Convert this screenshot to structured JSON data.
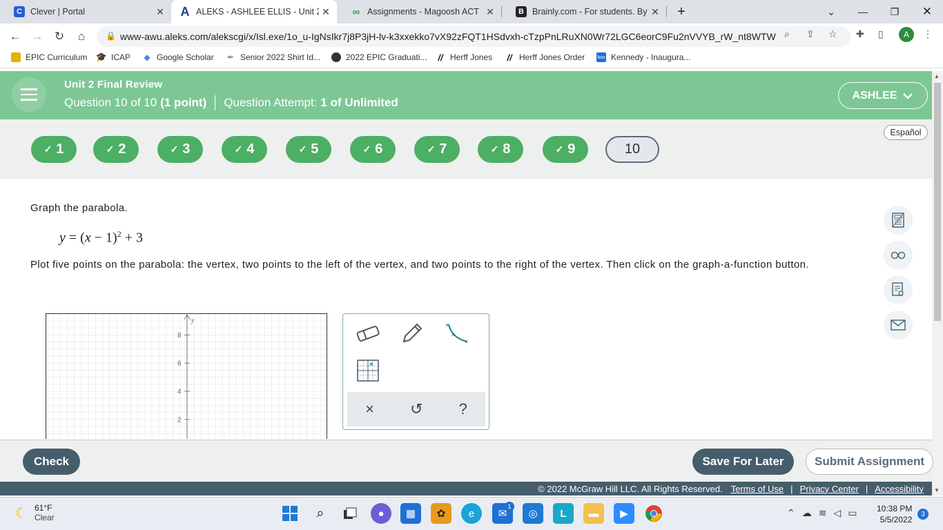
{
  "browser": {
    "tabs": [
      {
        "title": "Clever | Portal",
        "icon": "clever-icon",
        "color": "#2a5bd7",
        "glyph": "C"
      },
      {
        "title": "ALEKS - ASHLEE ELLIS - Unit 2 Fir",
        "icon": "aleks-icon",
        "color": "#ffffff",
        "glyph": "A"
      },
      {
        "title": "Assignments - Magoosh ACT",
        "icon": "magoosh-icon",
        "color": "#ffffff",
        "glyph": "∞"
      },
      {
        "title": "Brainly.com - For students. By stu",
        "icon": "brainly-icon",
        "color": "#222222",
        "glyph": "B"
      }
    ],
    "new_tab_label": "+",
    "url": "www-awu.aleks.com/alekscgi/x/Isl.exe/1o_u-IgNsIkr7j8P3jH-lv-k3xxekko7vX92zFQT1HSdvxh-cTzpPnLRuXN0Wr72LGC6eorC9Fu2nVVYB_rW_nt8WTWEO_...",
    "profile_initial": "A",
    "bookmarks": [
      {
        "label": "EPIC Curriculum",
        "color": "#e8b100"
      },
      {
        "label": "ICAP",
        "color": "#222222"
      },
      {
        "label": "Google Scholar",
        "color": "#4285f4"
      },
      {
        "label": "Senior 2022 Shirt Id...",
        "color": "#888888"
      },
      {
        "label": "2022 EPIC Graduati...",
        "color": "#333333"
      },
      {
        "label": "Herff Jones",
        "color": "#111111"
      },
      {
        "label": "Herff Jones Order",
        "color": "#111111"
      },
      {
        "label": "Kennedy - Inaugura...",
        "color": "#1f6fd6"
      }
    ]
  },
  "header": {
    "unit_title": "Unit 2 Final Review",
    "question_prefix": "Question 10 of 10",
    "question_points": "(1 point)",
    "attempt_prefix": "Question Attempt:",
    "attempt_value": "1 of Unlimited",
    "user_name": "ASHLEE"
  },
  "qnav": {
    "items": [
      {
        "label": "1",
        "done": true
      },
      {
        "label": "2",
        "done": true
      },
      {
        "label": "3",
        "done": true
      },
      {
        "label": "4",
        "done": true
      },
      {
        "label": "5",
        "done": true
      },
      {
        "label": "6",
        "done": true
      },
      {
        "label": "7",
        "done": true
      },
      {
        "label": "8",
        "done": true
      },
      {
        "label": "9",
        "done": true
      },
      {
        "label": "10",
        "done": false
      }
    ],
    "check_glyph": "✓",
    "language_label": "Español"
  },
  "question": {
    "prompt": "Graph the parabola.",
    "equation": {
      "lhs": "y",
      "eq": " = (",
      "x": "x",
      "rest": " − 1)",
      "exp": "2",
      "tail": " + 3"
    },
    "instructions": "Plot five points on the parabola: the vertex, two points to the left of the vertex, and two points to the right of the vertex. Then click on the graph-a-function button."
  },
  "graph": {
    "y_axis_label": "y",
    "y_ticks": [
      {
        "label": "8",
        "value": 8
      },
      {
        "label": "6",
        "value": 6
      },
      {
        "label": "4",
        "value": 4
      },
      {
        "label": "2",
        "value": 2
      }
    ],
    "x_min": -10,
    "x_max": 10,
    "y_max": 9
  },
  "tools": {
    "eraser": "eraser-icon",
    "pencil": "pencil-icon",
    "graph_function": "graph-a-function-icon",
    "point_grid": "point-grid-icon",
    "clear_label": "×",
    "undo_label": "↺",
    "help_label": "?"
  },
  "footer": {
    "check_label": "Check",
    "save_label": "Save For Later",
    "submit_label": "Submit Assignment",
    "copyright": "© 2022 McGraw Hill LLC. All Rights Reserved.",
    "terms": "Terms of Use",
    "privacy": "Privacy Center",
    "accessibility": "Accessibility"
  },
  "taskbar": {
    "temperature": "61°F",
    "condition": "Clear",
    "mail_badge": "1",
    "time": "10:38 PM",
    "date": "5/5/2022",
    "notifications": "3"
  }
}
